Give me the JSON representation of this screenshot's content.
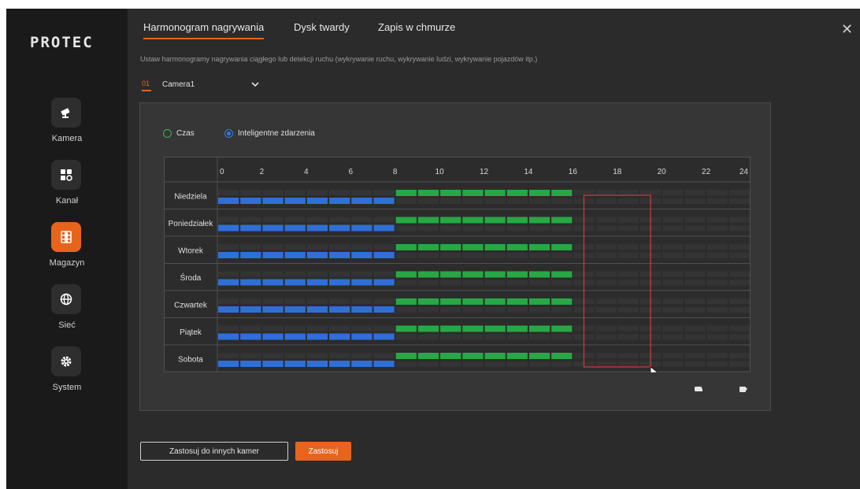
{
  "app": {
    "logo": "PROTEC"
  },
  "sidebar": {
    "items": [
      {
        "label": "Kamera",
        "icon": "camera-icon",
        "active": false
      },
      {
        "label": "Kanał",
        "icon": "channel-grid-icon",
        "active": false
      },
      {
        "label": "Magazyn",
        "icon": "film-storage-icon",
        "active": true
      },
      {
        "label": "Sieć",
        "icon": "globe-icon",
        "active": false
      },
      {
        "label": "System",
        "icon": "gear-icon",
        "active": false
      }
    ]
  },
  "tabs": [
    {
      "label": "Harmonogram nagrywania",
      "active": true
    },
    {
      "label": "Dysk twardy",
      "active": false
    },
    {
      "label": "Zapis w chmurze",
      "active": false
    }
  ],
  "description": "Ustaw harmonogramy nagrywania ciągłego lub detekcji ruchu (wykrywanie ruchu, wykrywanie ludzi, wykrywanie pojazdów itp.)",
  "camera": {
    "number": "01",
    "name": "Camera1"
  },
  "mode": {
    "options": [
      {
        "label": "Czas",
        "selected": false,
        "color": "#3cb44b"
      },
      {
        "label": "Inteligentne zdarzenia",
        "selected": true,
        "color": "#2f7be6"
      }
    ]
  },
  "schedule": {
    "hour_labels": [
      "0",
      "2",
      "4",
      "6",
      "8",
      "10",
      "12",
      "14",
      "16",
      "18",
      "20",
      "22",
      "24"
    ],
    "colors": {
      "continuous": "#2f6fd8",
      "events": "#27a844",
      "selection": "#d13a3a"
    },
    "days": [
      {
        "label": "Niedziela",
        "continuous_hours": [
          0,
          8
        ],
        "event_hours": [
          8,
          16
        ]
      },
      {
        "label": "Poniedziałek",
        "continuous_hours": [
          0,
          8
        ],
        "event_hours": [
          8,
          16
        ]
      },
      {
        "label": "Wtorek",
        "continuous_hours": [
          0,
          8
        ],
        "event_hours": [
          8,
          16
        ]
      },
      {
        "label": "Środa",
        "continuous_hours": [
          0,
          8
        ],
        "event_hours": [
          8,
          16
        ]
      },
      {
        "label": "Czwartek",
        "continuous_hours": [
          0,
          8
        ],
        "event_hours": [
          8,
          16
        ]
      },
      {
        "label": "Piątek",
        "continuous_hours": [
          0,
          8
        ],
        "event_hours": [
          8,
          16
        ]
      },
      {
        "label": "Sobota",
        "continuous_hours": [
          0,
          8
        ],
        "event_hours": [
          8,
          16
        ]
      }
    ],
    "selection": {
      "hours": [
        16.5,
        19.5
      ],
      "days": [
        "Niedziela",
        "Sobota"
      ]
    }
  },
  "panel_actions": [
    {
      "icon": "erase-schedule-icon"
    },
    {
      "icon": "copy-schedule-icon"
    }
  ],
  "buttons": {
    "apply_other": "Zastosuj do innych kamer",
    "apply": "Zastosuj"
  },
  "accent_color": "#e8641b"
}
